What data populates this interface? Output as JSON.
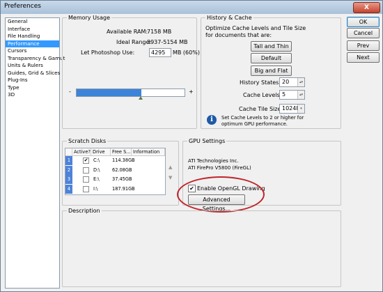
{
  "window": {
    "title": "Preferences",
    "close_label": "X"
  },
  "sidebar": {
    "items": [
      {
        "label": "General",
        "selected": false
      },
      {
        "label": "Interface",
        "selected": false
      },
      {
        "label": "File Handling",
        "selected": false
      },
      {
        "label": "Performance",
        "selected": true
      },
      {
        "label": "Cursors",
        "selected": false
      },
      {
        "label": "Transparency & Gamut",
        "selected": false
      },
      {
        "label": "Units & Rulers",
        "selected": false
      },
      {
        "label": "Guides, Grid & Slices",
        "selected": false
      },
      {
        "label": "Plug-Ins",
        "selected": false
      },
      {
        "label": "Type",
        "selected": false
      },
      {
        "label": "3D",
        "selected": false
      }
    ]
  },
  "buttons": {
    "ok": "OK",
    "cancel": "Cancel",
    "prev": "Prev",
    "next": "Next"
  },
  "memory": {
    "legend": "Memory Usage",
    "available_label": "Available RAM:",
    "available_value": "7158 MB",
    "ideal_label": "Ideal Range:",
    "ideal_value": "3937-5154 MB",
    "let_label": "Let Photoshop Use:",
    "let_value": "4295",
    "let_suffix": "MB (60%)",
    "slider_min": "-",
    "slider_max": "+",
    "slider_level": 0.6
  },
  "history": {
    "legend": "History & Cache",
    "desc": "Optimize Cache Levels and Tile Size for documents that are:",
    "btn_tall": "Tall and Thin",
    "btn_default": "Default",
    "btn_big": "Big and Flat",
    "states_label": "History States:",
    "states_value": "20",
    "levels_label": "Cache Levels:",
    "levels_value": "5",
    "tile_label": "Cache Tile Size:",
    "tile_value": "1024K",
    "info": "Set Cache Levels to 2 or higher for optimum GPU performance."
  },
  "scratch": {
    "legend": "Scratch Disks",
    "headers": [
      "Active?",
      "Drive",
      "Free S...",
      "Information"
    ],
    "rows": [
      {
        "num": "1",
        "active": true,
        "drive": "C:\\",
        "free": "114.38GB"
      },
      {
        "num": "2",
        "active": false,
        "drive": "D:\\",
        "free": "62.08GB"
      },
      {
        "num": "3",
        "active": false,
        "drive": "E:\\",
        "free": "37.45GB"
      },
      {
        "num": "4",
        "active": false,
        "drive": "I:\\",
        "free": "187.91GB"
      }
    ]
  },
  "gpu": {
    "legend": "GPU Settings",
    "vendor": "ATI Technologies Inc.",
    "model": "ATI FirePro V5800 (FireGL)",
    "opengl_label": "Enable OpenGL Drawing",
    "opengl_checked": true,
    "advanced": "Advanced Settings..."
  },
  "description": {
    "legend": "Description"
  },
  "colors": {
    "accent": "#3399ff",
    "annotation": "#c0242a"
  }
}
